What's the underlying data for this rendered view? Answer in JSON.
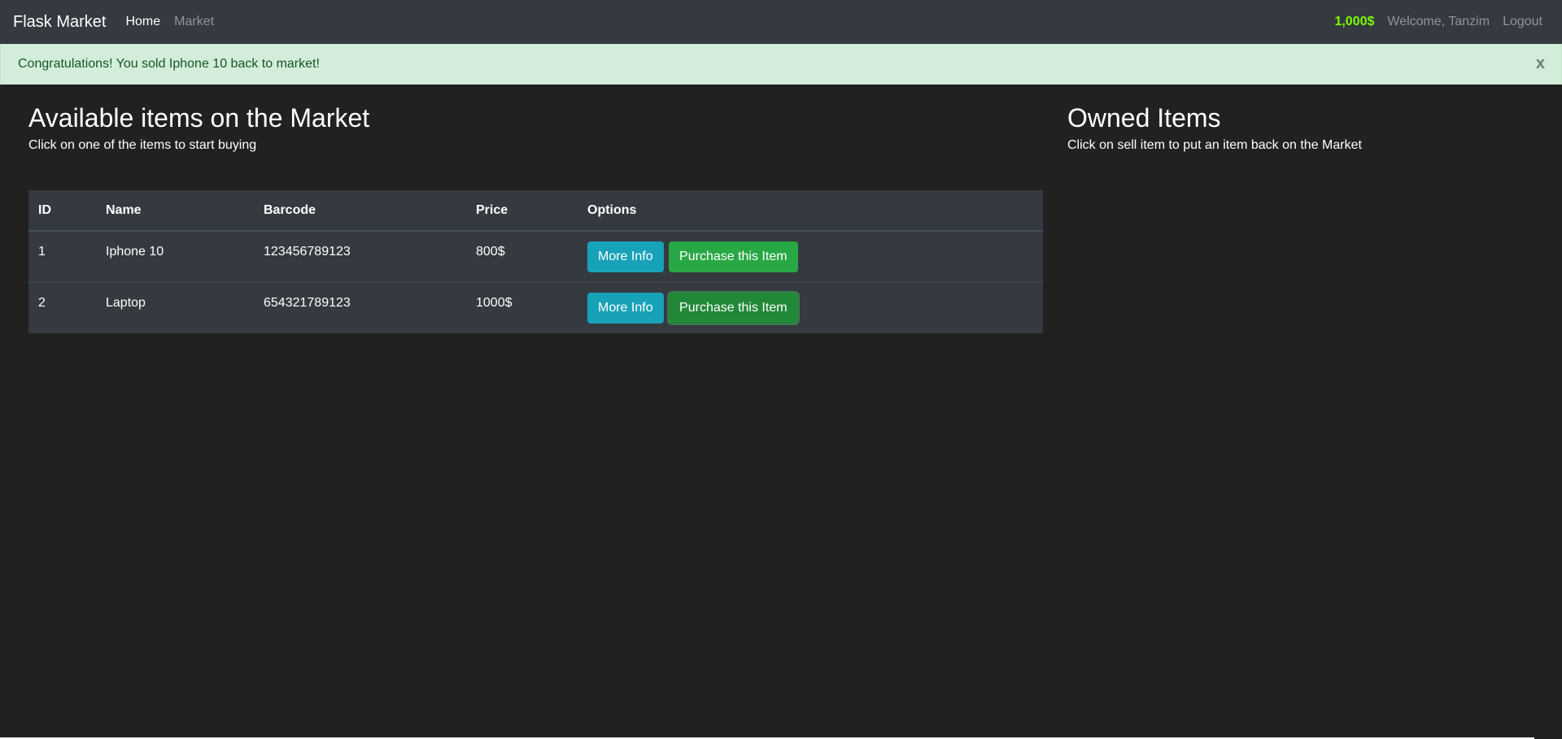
{
  "navbar": {
    "brand": "Flask Market",
    "links": [
      {
        "label": "Home",
        "active": true
      },
      {
        "label": "Market",
        "active": false
      }
    ],
    "budget": "1,000$",
    "welcome": "Welcome, Tanzim",
    "logout": "Logout"
  },
  "alert": {
    "message": "Congratulations! You sold Iphone 10 back to market!",
    "close": "x"
  },
  "market": {
    "title": "Available items on the Market",
    "subtitle": "Click on one of the items to start buying",
    "columns": [
      "ID",
      "Name",
      "Barcode",
      "Price",
      "Options"
    ],
    "rows": [
      {
        "id": "1",
        "name": "Iphone 10",
        "barcode": "123456789123",
        "price": "800$",
        "more_info": "More Info",
        "purchase": "Purchase this Item"
      },
      {
        "id": "2",
        "name": "Laptop",
        "barcode": "654321789123",
        "price": "1000$",
        "more_info": "More Info",
        "purchase": "Purchase this Item"
      }
    ]
  },
  "owned": {
    "title": "Owned Items",
    "subtitle": "Click on sell item to put an item back on the Market"
  },
  "colors": {
    "navbar_bg": "#343a40",
    "page_bg": "#212121",
    "budget": "#7cfc00",
    "alert_bg": "#d4edda",
    "info_button": "#17a2b8",
    "success_button": "#28a745"
  }
}
